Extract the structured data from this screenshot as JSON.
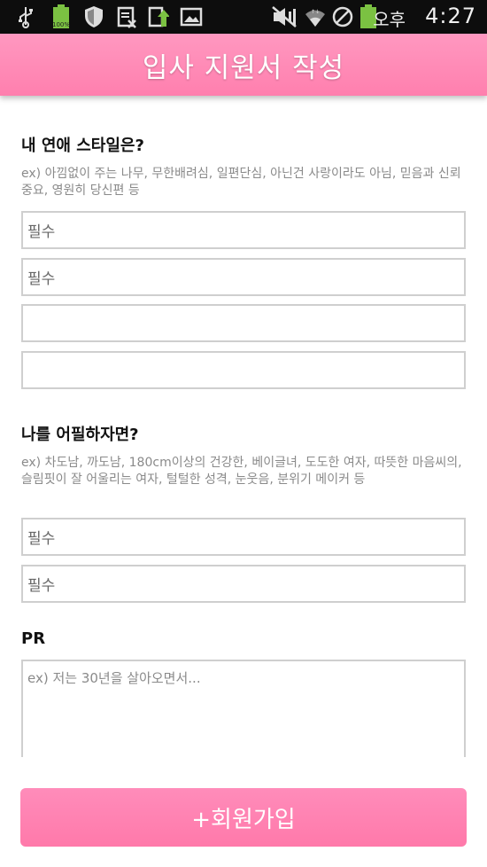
{
  "status_bar": {
    "icons": [
      "usb-icon",
      "battery-full-icon",
      "shield-icon",
      "calendar-icon",
      "upload-icon",
      "image-icon",
      "mute-icon",
      "wifi-icon",
      "no-sign-icon",
      "battery-icon"
    ],
    "battery_small_label": "100%",
    "ampm": "오후",
    "time": "4:27"
  },
  "header": {
    "title": "입사 지원서 작성"
  },
  "section1": {
    "title": "내 연애 스타일은?",
    "hint": "ex) 아낌없이 주는 나무, 무한배려심, 일편단심, 아닌건 사랑이라도 아님, 믿음과 신뢰 중요, 영원히 당신편 등",
    "fields": [
      {
        "value": "필수"
      },
      {
        "value": "필수"
      },
      {
        "value": ""
      },
      {
        "value": ""
      }
    ]
  },
  "section2": {
    "title": "나를 어필하자면?",
    "hint": "ex) 차도남, 까도남, 180cm이상의 건강한, 베이글녀, 도도한 여자, 따뜻한 마음씨의, 슬림핏이 잘 어울리는 여자, 털털한 성격, 눈웃음, 분위기 메이커 등",
    "fields": [
      {
        "value": "필수"
      },
      {
        "value": "필수"
      }
    ]
  },
  "section3": {
    "title": "PR",
    "placeholder": "ex) 저는 30년을 살아오면서..."
  },
  "submit_label": "+회원가입",
  "colors": {
    "accent": "#ff85b3",
    "border": "#cfcfcf",
    "hint": "#8a8a8a"
  }
}
